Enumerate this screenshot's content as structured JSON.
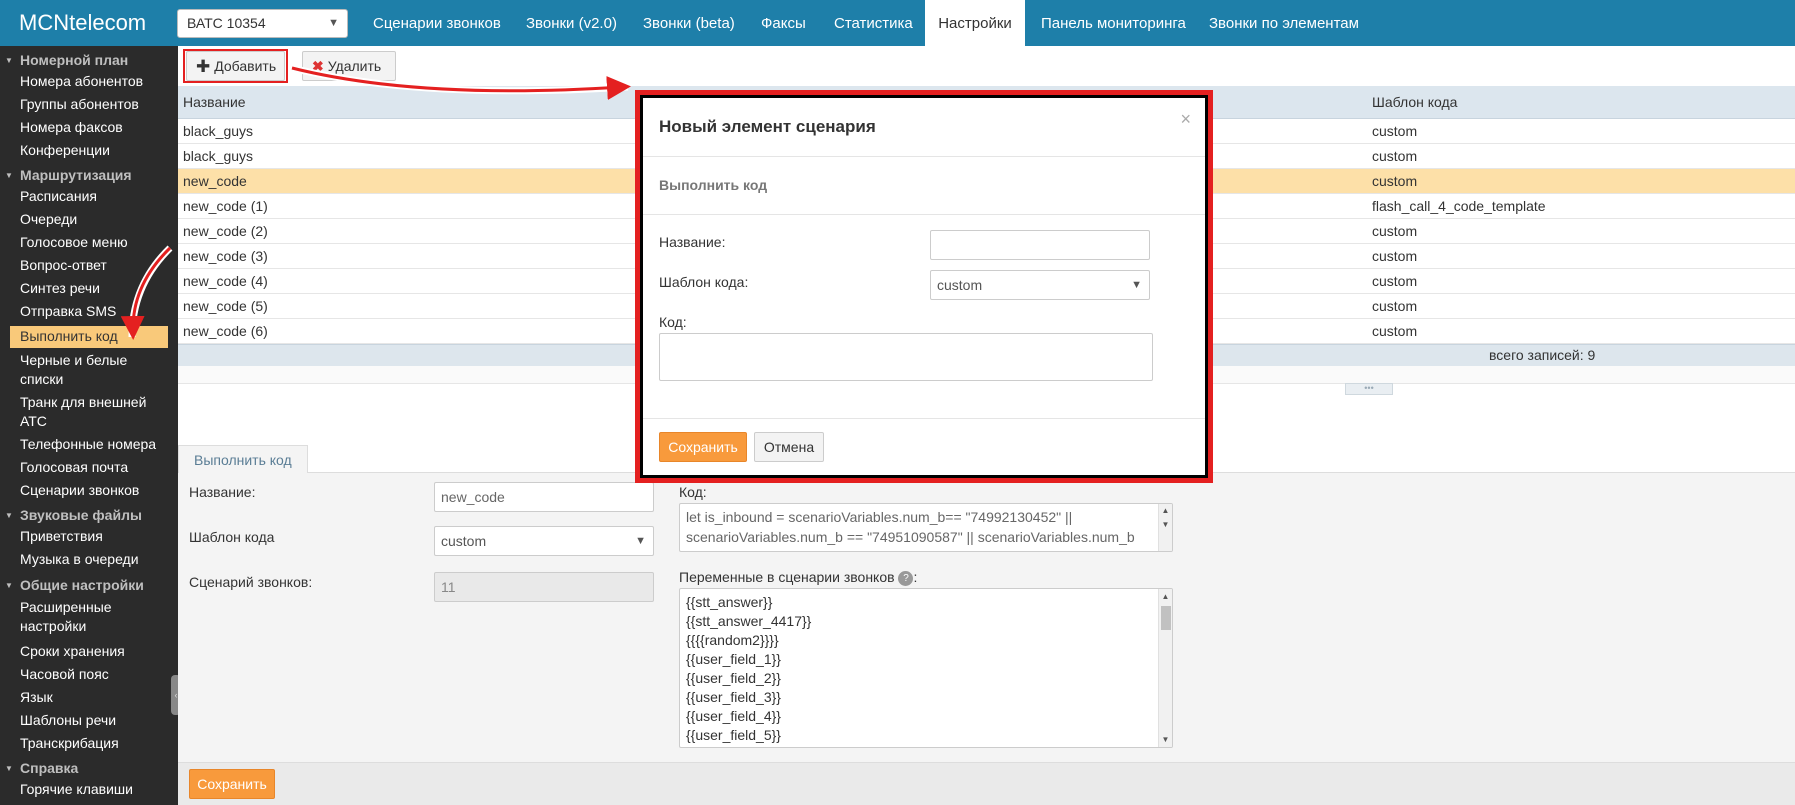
{
  "brand": "MCNtelecom",
  "vats_select": "ВАТС 10354",
  "top_nav": [
    "Сценарии звонков",
    "Звонки (v2.0)",
    "Звонки (beta)",
    "Факсы",
    "Статистика",
    "Настройки",
    "Панель мониторинга",
    "Звонки по элементам"
  ],
  "top_nav_active": "Настройки",
  "sidebar": {
    "sections": [
      {
        "title": "Номерной план",
        "items": [
          "Номера абонентов",
          "Группы абонентов",
          "Номера факсов",
          "Конференции"
        ]
      },
      {
        "title": "Маршрутизация",
        "items": [
          "Расписания",
          "Очереди",
          "Голосовое меню",
          "Вопрос-ответ",
          "Синтез речи",
          "Отправка SMS",
          "Выполнить код",
          "Черные и белые",
          "списки",
          "Транк для внешней",
          "АТС",
          "Телефонные номера",
          "Голосовая почта",
          "Сценарии звонков"
        ]
      },
      {
        "title": "Звуковые файлы",
        "items": [
          "Приветствия",
          "Музыка в очереди"
        ]
      },
      {
        "title": "Общие настройки",
        "items": [
          "Расширенные",
          "настройки",
          "Сроки хранения",
          "Часовой пояс",
          "Язык",
          "Шаблоны речи",
          "Транскрибация"
        ]
      },
      {
        "title": "Справка",
        "items": [
          "Горячие клавиши"
        ]
      }
    ],
    "selected": "Выполнить код"
  },
  "toolbar": {
    "add_label": "Добавить",
    "delete_label": "Удалить"
  },
  "table": {
    "headers": [
      "Название",
      "Шаблон кода"
    ],
    "rows": [
      [
        "black_guys",
        "custom"
      ],
      [
        "black_guys",
        "custom"
      ],
      [
        "new_code",
        "custom"
      ],
      [
        "new_code (1)",
        "flash_call_4_code_template"
      ],
      [
        "new_code (2)",
        "custom"
      ],
      [
        "new_code (3)",
        "custom"
      ],
      [
        "new_code (4)",
        "custom"
      ],
      [
        "new_code (5)",
        "custom"
      ],
      [
        "new_code (6)",
        "custom"
      ]
    ],
    "highlighted_row": 2,
    "total": "всего записей: 9"
  },
  "detail": {
    "tab": "Выполнить код",
    "name_label": "Название:",
    "name_value": "new_code",
    "template_label": "Шаблон кода",
    "template_value": "custom",
    "scenario_label": "Сценарий звонков:",
    "scenario_value": "11",
    "code_label": "Код:",
    "code_lines": [
      "let is_inbound = scenarioVariables.num_b== \"74992130452\" ||",
      "scenarioVariables.num_b == \"74951090587\" || scenarioVariables.num_b"
    ],
    "vars_label": "Переменные в сценарии звонков",
    "vars_help": "?",
    "vars_suffix": ":",
    "vars": [
      "{{stt_answer}}",
      "{{stt_answer_4417}}",
      "{{{{random2}}}}",
      "{{user_field_1}}",
      "{{user_field_2}}",
      "{{user_field_3}}",
      "{{user_field_4}}",
      "{{user_field_5}}"
    ],
    "save_label": "Сохранить"
  },
  "modal": {
    "title": "Новый элемент сценария",
    "close": "×",
    "subtitle": "Выполнить код",
    "name_label": "Название:",
    "name_value": "",
    "template_label": "Шаблон кода:",
    "template_value": "custom",
    "code_label": "Код:",
    "save_label": "Сохранить",
    "cancel_label": "Отмена"
  },
  "colors": {
    "topbar": "#1e7fa9",
    "sidebar": "#2b2b2b",
    "selected": "#f9c97a",
    "accent": "#f89a3c",
    "annotation": "#e42020"
  }
}
